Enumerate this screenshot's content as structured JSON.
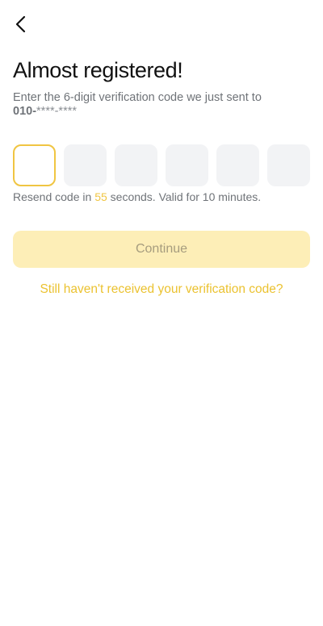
{
  "header": {
    "back_icon": "chevron-left-icon"
  },
  "main": {
    "title": "Almost registered!",
    "subtitle": "Enter the 6-digit verification code we just sent to",
    "phone_prefix": "010-",
    "phone_masked": "****-****",
    "otp": {
      "length": 6,
      "active_index": 0,
      "digits": [
        "",
        "",
        "",
        "",
        "",
        ""
      ]
    },
    "resend": {
      "before": "Resend code in ",
      "seconds": "55",
      "after": " seconds. Valid for 10 minutes."
    },
    "continue_label": "Continue",
    "help_link": "Still haven't received your verification code?"
  },
  "colors": {
    "accent": "#f0c542",
    "button_disabled_bg": "#fdeeb7",
    "input_bg": "#f2f3f5"
  }
}
